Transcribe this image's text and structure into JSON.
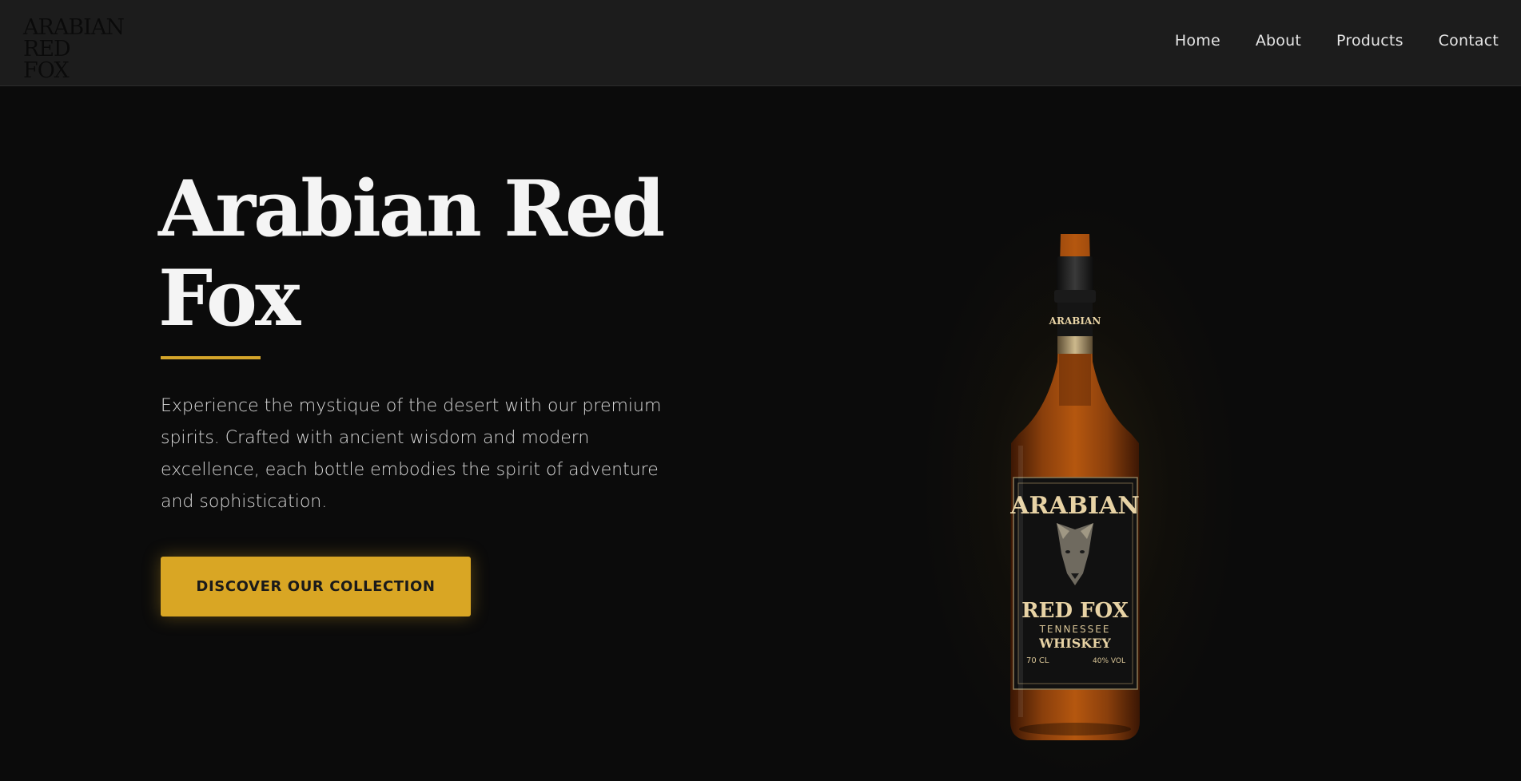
{
  "brand": {
    "logo_line1": "ARABIAN",
    "logo_line2": "RED FOX"
  },
  "nav": {
    "items": [
      {
        "label": "Home"
      },
      {
        "label": "About"
      },
      {
        "label": "Products"
      },
      {
        "label": "Contact"
      }
    ]
  },
  "hero": {
    "title_line1": "Arabian Red",
    "title_line2": "Fox",
    "description": "Experience the mystique of the desert with our premium spirits. Crafted with ancient wisdom and modern excellence, each bottle embodies the spirit of adventure and sophistication.",
    "cta_label": "DISCOVER OUR COLLECTION"
  },
  "product": {
    "neck_label": "ARABIAN",
    "label_top": "ARABIAN",
    "label_name": "RED FOX",
    "label_origin": "TENNESSEE",
    "label_type": "WHISKEY",
    "label_volume": "70 CL",
    "label_abv": "40% VOL"
  },
  "colors": {
    "background": "#0b0b0b",
    "header": "#1c1c1c",
    "accent": "#d9a624",
    "text_primary": "#f4f4f4",
    "text_secondary": "#d9d9d9",
    "whiskey": "#8a3f0c",
    "label_cream": "#e8d3a5"
  },
  "icons": {
    "logo": "brand-wordmark",
    "fox": "fox-head-illustration"
  }
}
